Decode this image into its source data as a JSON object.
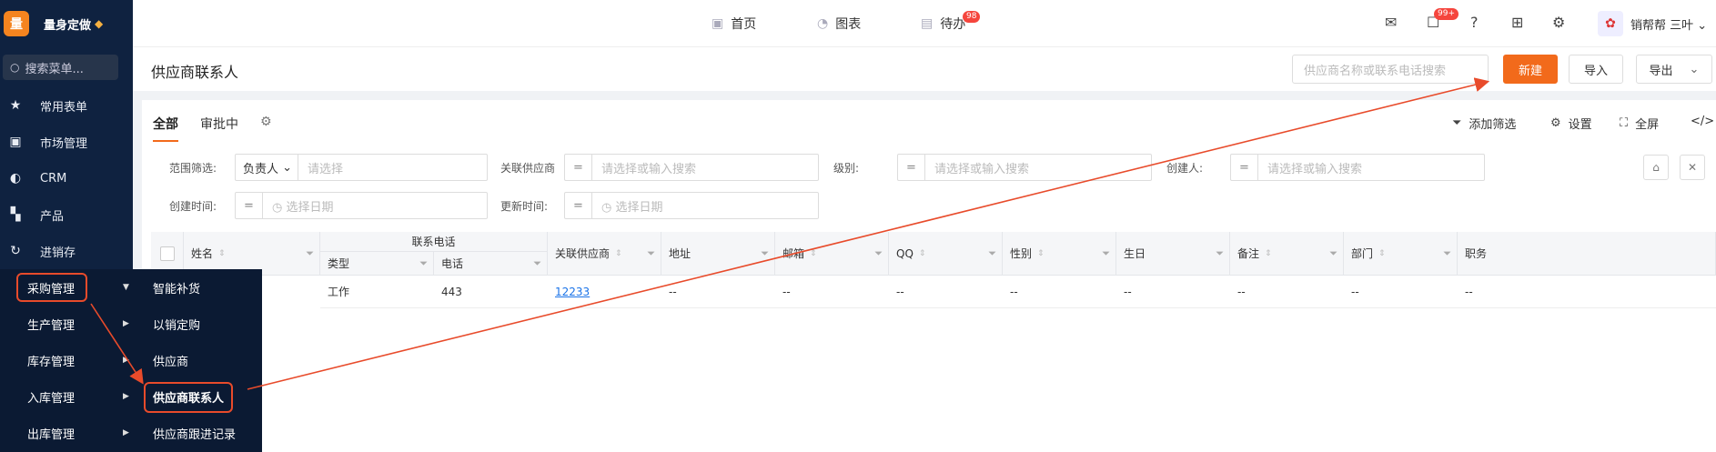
{
  "brand": {
    "logo_char": "量",
    "name": "量身定做"
  },
  "sidebar": {
    "search_placeholder": "搜索菜单...",
    "items": [
      {
        "label": "常用表单",
        "icon": "star-icon"
      },
      {
        "label": "市场管理",
        "icon": "clipboard-icon"
      },
      {
        "label": "CRM",
        "icon": "pie-icon"
      },
      {
        "label": "产品",
        "icon": "boxes-icon"
      },
      {
        "label": "进销存",
        "icon": "cycle-icon"
      }
    ]
  },
  "submenu": {
    "left": [
      "采购管理",
      "生产管理",
      "库存管理",
      "入库管理",
      "出库管理"
    ],
    "right": [
      "智能补货",
      "以销定购",
      "供应商",
      "供应商联系人",
      "供应商跟进记录"
    ]
  },
  "topnav": {
    "home": "首页",
    "charts": "图表",
    "todo": "待办",
    "todo_badge": "98",
    "msg_badge": "99+",
    "user": "销帮帮 三叶"
  },
  "page": {
    "title": "供应商联系人",
    "search_placeholder": "供应商名称或联系电话搜索",
    "new_label": "新建",
    "import_label": "导入",
    "export_label": "导出"
  },
  "tabs": {
    "all": "全部",
    "pending": "审批中"
  },
  "tools": {
    "filter": "添加筛选",
    "settings": "设置",
    "fullscreen": "全屏",
    "code": "</>"
  },
  "filters": {
    "scope_label": "范围筛选:",
    "scope_value": "负责人",
    "scope_placeholder": "请选择",
    "supplier_label": "关联供应商",
    "supplier_placeholder": "请选择或输入搜索",
    "level_label": "级别:",
    "level_placeholder": "请选择或输入搜索",
    "creator_label": "创建人:",
    "creator_placeholder": "请选择或输入搜索",
    "created_label": "创建时间:",
    "created_placeholder": "选择日期",
    "updated_label": "更新时间:",
    "updated_placeholder": "选择日期",
    "eq": "="
  },
  "table": {
    "group_header": "联系电话",
    "headers": {
      "name": "姓名",
      "type": "类型",
      "phone": "电话",
      "supplier": "关联供应商",
      "address": "地址",
      "email": "邮箱",
      "qq": "QQ",
      "gender": "性别",
      "birthday": "生日",
      "remark": "备注",
      "dept": "部门",
      "job": "职务"
    },
    "row": {
      "type": "工作",
      "phone": "443",
      "supplier": "12233",
      "address": "--",
      "email": "--",
      "qq": "--",
      "gender": "--",
      "birthday": "--",
      "remark": "--",
      "dept": "--",
      "job": "--"
    }
  },
  "colors": {
    "accent": "#f26a1b",
    "sidebar_bg": "#0f2240",
    "annotation": "#e84b2b"
  }
}
